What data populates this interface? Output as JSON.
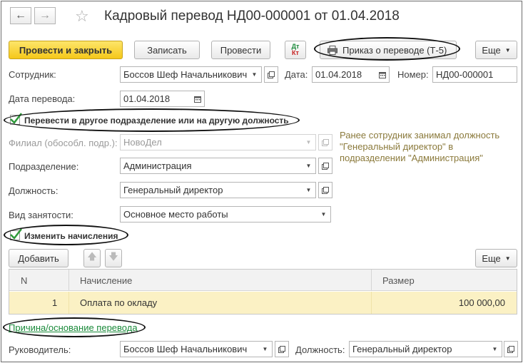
{
  "window": {
    "title": "Кадровый перевод НД00-000001 от 01.04.2018"
  },
  "toolbar": {
    "post_close_label": "Провести и закрыть",
    "save_label": "Записать",
    "post_label": "Провести",
    "dtkt_label_dt": "Дт",
    "dtkt_label_kt": "Кт",
    "print_order_label": "Приказ о переводе (Т-5)",
    "more_label": "Еще"
  },
  "header": {
    "employee_label": "Сотрудник:",
    "employee_value": "Боссов Шеф Начальникович",
    "date_label": "Дата:",
    "date_value": "01.04.2018",
    "number_label": "Номер:",
    "number_value": "НД00-000001",
    "transfer_date_label": "Дата перевода:",
    "transfer_date_value": "01.04.2018"
  },
  "transfer": {
    "checkbox_label": "Перевести в другое подразделение или на другую должность",
    "checked": true,
    "branch_label": "Филиал (обособл. подр.):",
    "branch_value": "НовоДел",
    "department_label": "Подразделение:",
    "department_value": "Администрация",
    "position_label": "Должность:",
    "position_value": "Генеральный директор",
    "employment_label": "Вид занятости:",
    "employment_value": "Основное место работы",
    "info_line1": "Ранее сотрудник занимал должность",
    "info_line2": "\"Генеральный директор\" в",
    "info_line3": "подразделении \"Администрация\""
  },
  "accruals": {
    "checkbox_label": "Изменить начисления",
    "checked": true,
    "add_label": "Добавить",
    "more_label": "Еще",
    "columns": [
      "N",
      "Начисление",
      "Размер"
    ],
    "rows": [
      {
        "n": "1",
        "accrual": "Оплата по окладу",
        "amount": "100 000,00"
      }
    ]
  },
  "footer": {
    "reason_link": "Причина/основание перевода",
    "manager_label": "Руководитель:",
    "manager_value": "Боссов Шеф Начальникович",
    "manager_position_label": "Должность:",
    "manager_position_value": "Генеральный директор"
  },
  "colors": {
    "primary_button": "#f5c81a",
    "link": "#1a8a3a",
    "info_text": "#8b7a3c",
    "selected_row": "#fbf1c4",
    "checkmark": "#2e9a3a"
  },
  "icons": [
    "back-arrow-icon",
    "forward-arrow-icon",
    "star-icon",
    "printer-icon",
    "calendar-icon",
    "open-icon",
    "chevron-down-icon",
    "up-arrow-icon",
    "down-arrow-icon",
    "checkmark-icon"
  ]
}
